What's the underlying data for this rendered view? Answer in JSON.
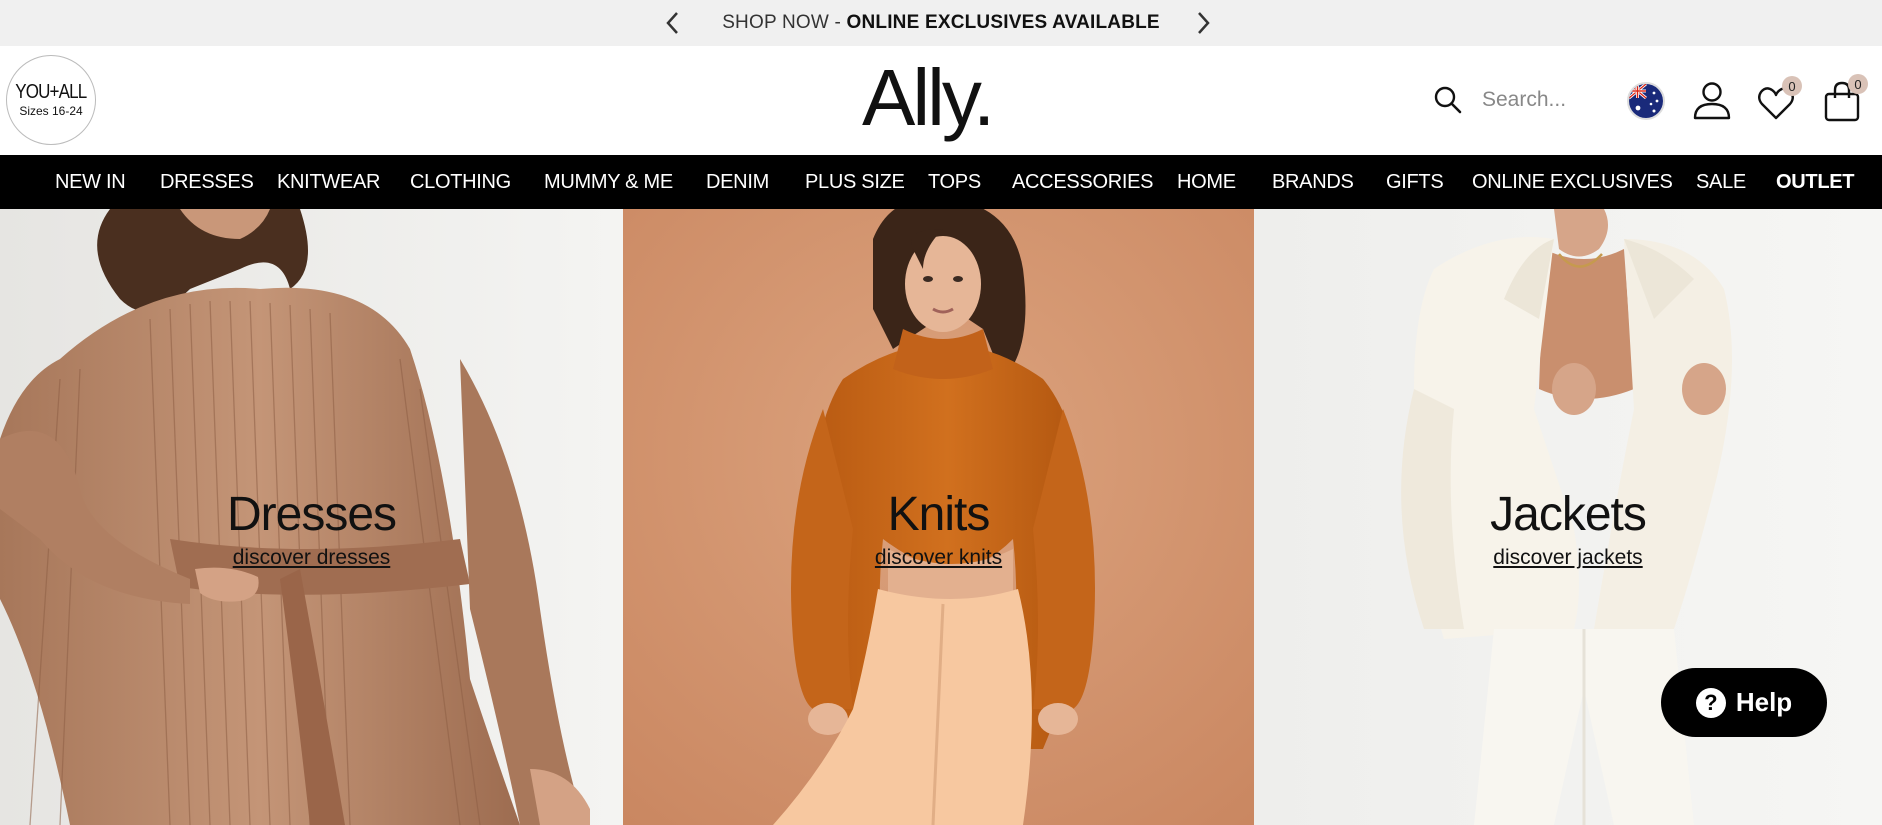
{
  "announcement": {
    "prefix": "SHOP NOW - ",
    "highlight": "ONLINE EXCLUSIVES AVAILABLE",
    "prev_icon": "chevron-left-icon",
    "next_icon": "chevron-right-icon"
  },
  "header": {
    "badge_top": "YOU+ALL",
    "badge_bottom": "Sizes 16-24",
    "logo": "Ally.",
    "search_placeholder": "Search...",
    "wishlist_count": "0",
    "cart_count": "0",
    "region_icon": "australia-flag-icon"
  },
  "nav": {
    "items": [
      {
        "label": "NEW IN"
      },
      {
        "label": "DRESSES"
      },
      {
        "label": "KNITWEAR"
      },
      {
        "label": "CLOTHING"
      },
      {
        "label": "MUMMY & ME"
      },
      {
        "label": "DENIM"
      },
      {
        "label": "PLUS SIZE"
      },
      {
        "label": "TOPS"
      },
      {
        "label": "ACCESSORIES"
      },
      {
        "label": "HOME"
      },
      {
        "label": "BRANDS"
      },
      {
        "label": "GIFTS"
      },
      {
        "label": "ONLINE EXCLUSIVES"
      },
      {
        "label": "SALE"
      },
      {
        "label": "OUTLET"
      }
    ]
  },
  "tiles": [
    {
      "title": "Dresses",
      "link": "discover dresses"
    },
    {
      "title": "Knits",
      "link": "discover knits"
    },
    {
      "title": "Jackets",
      "link": "discover jackets"
    }
  ],
  "help": {
    "label": "Help"
  },
  "colors": {
    "nav_bg": "#000000",
    "announce_bg": "#f0f0f0",
    "badge": "#d9c2b7"
  }
}
